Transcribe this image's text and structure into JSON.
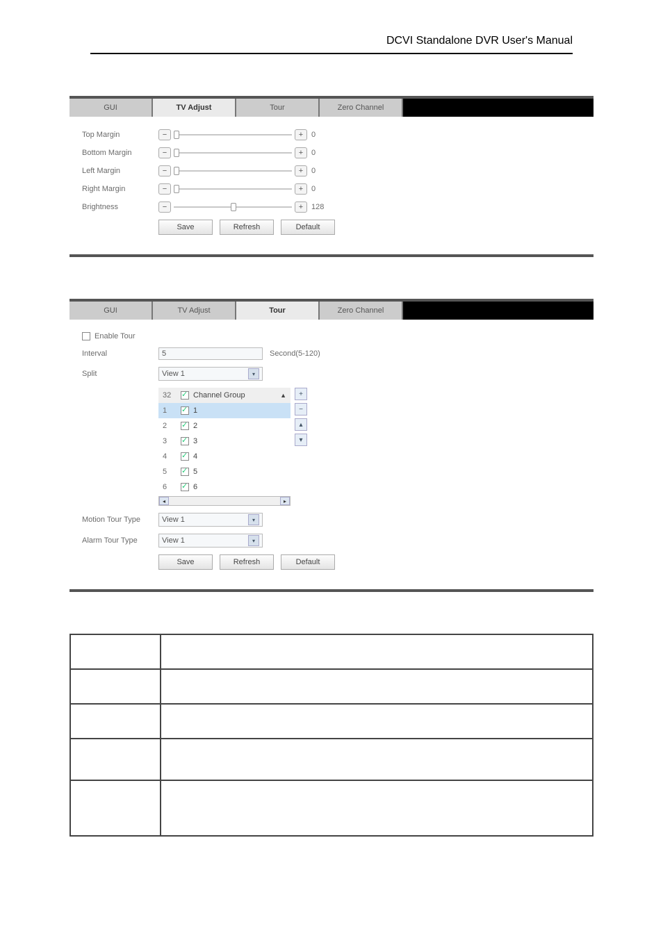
{
  "header": {
    "title": "DCVI Standalone DVR User's Manual"
  },
  "tabs": {
    "gui": "GUI",
    "tv": "TV Adjust",
    "tour": "Tour",
    "zero": "Zero Channel"
  },
  "tv_adjust": {
    "labels": {
      "top": "Top Margin",
      "bottom": "Bottom Margin",
      "left": "Left Margin",
      "right": "Right Margin",
      "brightness": "Brightness"
    },
    "values": {
      "top": "0",
      "bottom": "0",
      "left": "0",
      "right": "0",
      "brightness": "128"
    },
    "buttons": {
      "save": "Save",
      "refresh": "Refresh",
      "default": "Default"
    }
  },
  "tour": {
    "labels": {
      "enable": "Enable Tour",
      "interval": "Interval",
      "split": "Split",
      "motion_type": "Motion Tour Type",
      "alarm_type": "Alarm Tour Type"
    },
    "interval": {
      "value": "5",
      "suffix": "Second(5-120)"
    },
    "split_value": "View 1",
    "motion_value": "View 1",
    "alarm_value": "View 1",
    "list": {
      "count": "32",
      "header": "Channel Group",
      "items": [
        {
          "idx": "1",
          "label": "1"
        },
        {
          "idx": "2",
          "label": "2"
        },
        {
          "idx": "3",
          "label": "3"
        },
        {
          "idx": "4",
          "label": "4"
        },
        {
          "idx": "5",
          "label": "5"
        },
        {
          "idx": "6",
          "label": "6"
        }
      ]
    },
    "buttons": {
      "save": "Save",
      "refresh": "Refresh",
      "default": "Default"
    }
  },
  "doc_table": {
    "rows": [
      {
        "param": "",
        "desc": ""
      },
      {
        "param": "",
        "desc": ""
      },
      {
        "param": "",
        "desc": ""
      },
      {
        "param": "",
        "desc": ""
      },
      {
        "param": "",
        "desc": ""
      }
    ]
  }
}
